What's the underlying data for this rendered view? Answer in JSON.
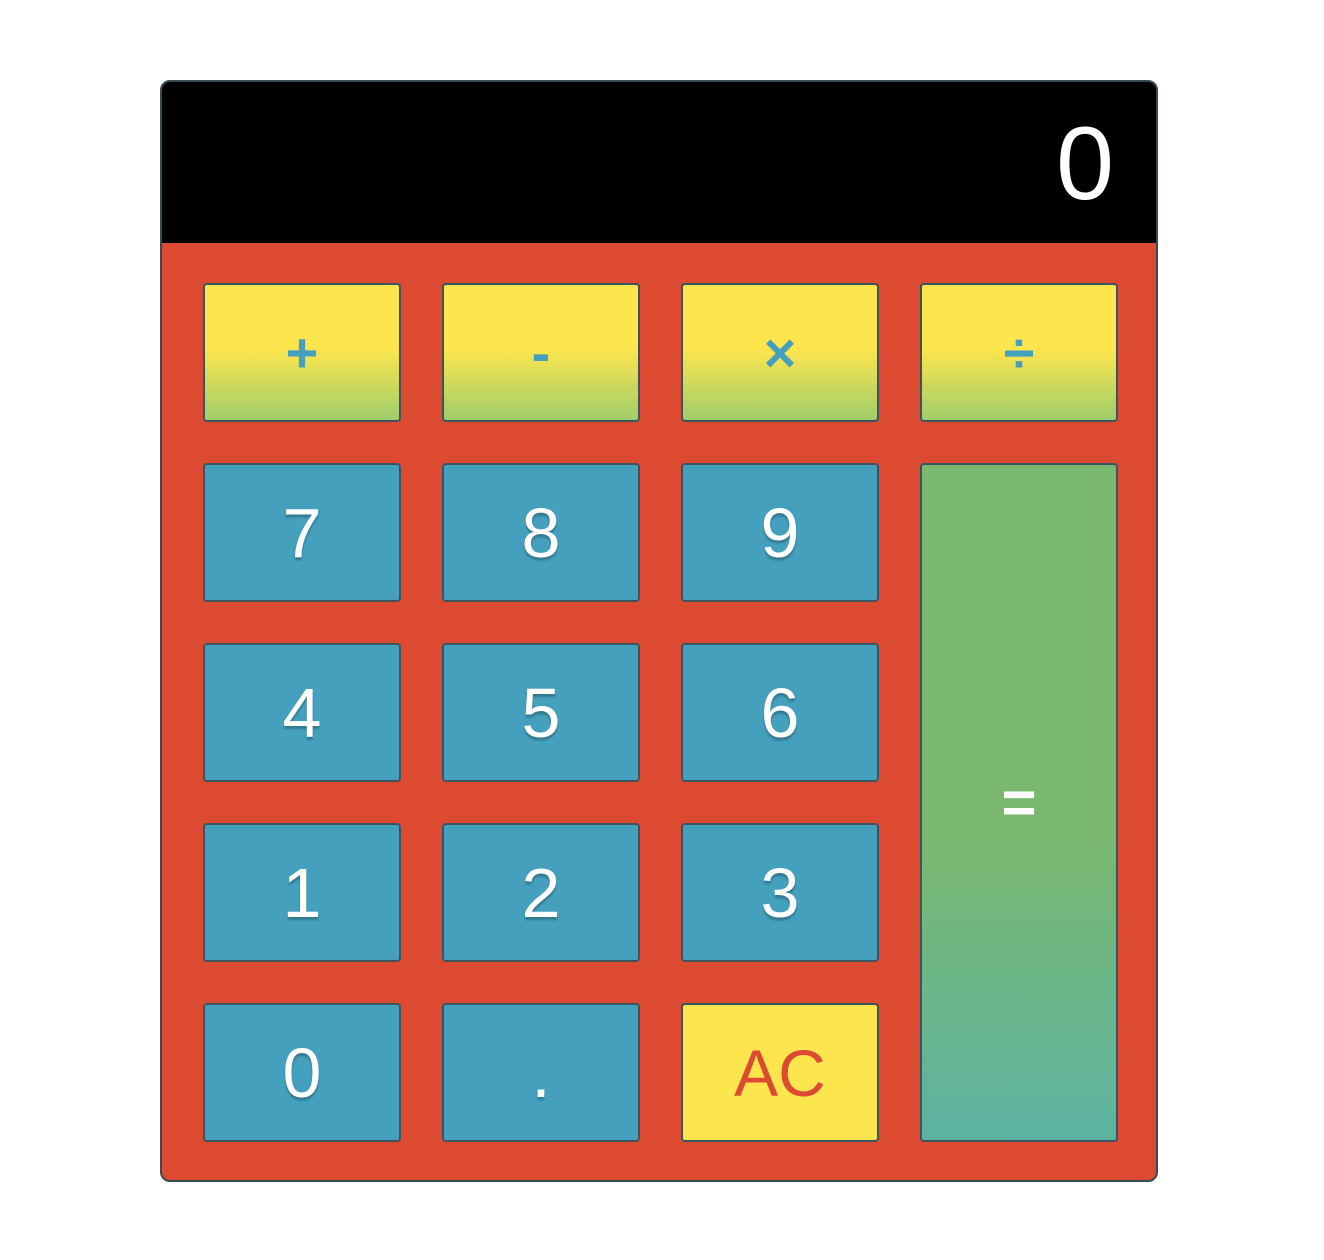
{
  "display": {
    "value": "0"
  },
  "operators": {
    "add": "+",
    "subtract": "-",
    "multiply": "×",
    "divide": "÷"
  },
  "digits": {
    "seven": "7",
    "eight": "8",
    "nine": "9",
    "four": "4",
    "five": "5",
    "six": "6",
    "one": "1",
    "two": "2",
    "three": "3",
    "zero": "0"
  },
  "keys": {
    "decimal": ".",
    "clear": "AC",
    "equals": "="
  },
  "colors": {
    "body": "#dc4a32",
    "display": "#000000",
    "number_key": "#45a0be",
    "operator_key_top": "#fce54d",
    "operator_key_bottom": "#9fcd6b",
    "equals_key_top": "#7ab870",
    "equals_key_bottom": "#5db3a1",
    "clear_text": "#dc4a32"
  }
}
